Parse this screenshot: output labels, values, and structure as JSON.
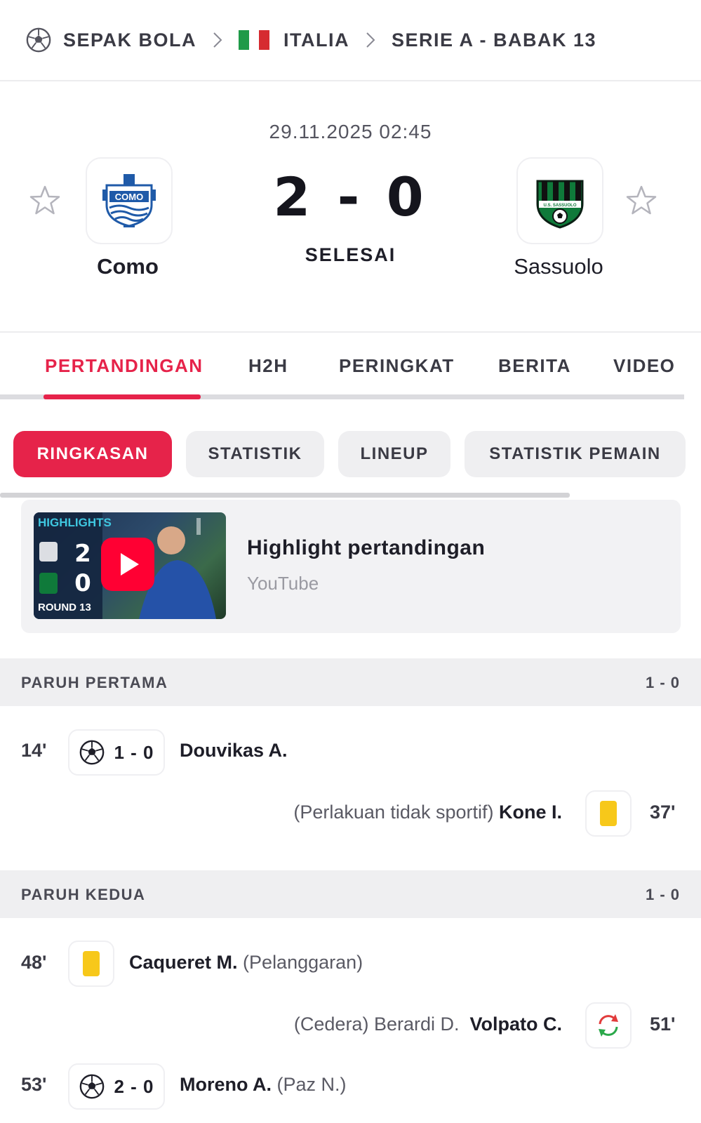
{
  "breadcrumb": {
    "sport": "SEPAK BOLA",
    "country": "ITALIA",
    "competition": "SERIE A - BABAK 13",
    "flag_colors": [
      "#1f9a48",
      "#ffffff",
      "#d62b30"
    ]
  },
  "match": {
    "datetime": "29.11.2025 02:45",
    "home_team": "Como",
    "away_team": "Sassuolo",
    "score": "2 - 0",
    "status": "SELESAI",
    "home_logo_text": "COMO",
    "away_logo_text": "U.S. SASSUOLO"
  },
  "tabs": [
    "PERTANDINGAN",
    "H2H",
    "PERINGKAT",
    "BERITA",
    "VIDEO"
  ],
  "subtabs": [
    "RINGKASAN",
    "STATISTIK",
    "LINEUP",
    "STATISTIK PEMAIN"
  ],
  "highlight": {
    "title": "Highlight pertandingan",
    "source": "YouTube",
    "thumb_label": "HIGHLIGHTS",
    "thumb_score_home": "2",
    "thumb_score_away": "0",
    "thumb_round": "ROUND 13"
  },
  "first_half": {
    "label": "PARUH PERTAMA",
    "score": "1 - 0",
    "events": [
      {
        "minute": "14'",
        "type": "goal",
        "score": "1 - 0",
        "player": "Douvikas A.",
        "note": ""
      },
      {
        "minute": "37'",
        "type": "yellow-card",
        "player": "Kone I.",
        "note": "(Perlakuan tidak sportif)"
      }
    ]
  },
  "second_half": {
    "label": "PARUH KEDUA",
    "score": "1 - 0",
    "events": [
      {
        "minute": "48'",
        "type": "yellow-card",
        "player": "Caqueret M.",
        "note": "(Pelanggaran)"
      },
      {
        "minute": "51'",
        "type": "substitution",
        "player": "Volpato C.",
        "note": "(Cedera) Berardi D."
      },
      {
        "minute": "53'",
        "type": "goal",
        "score": "2 - 0",
        "player": "Moreno A.",
        "note": "(Paz N.)"
      }
    ]
  },
  "colors": {
    "accent": "#e6234a",
    "yellow_card": "#f7c81a",
    "como_blue": "#1f5aa8",
    "sassuolo_green": "#0f7a3a"
  }
}
